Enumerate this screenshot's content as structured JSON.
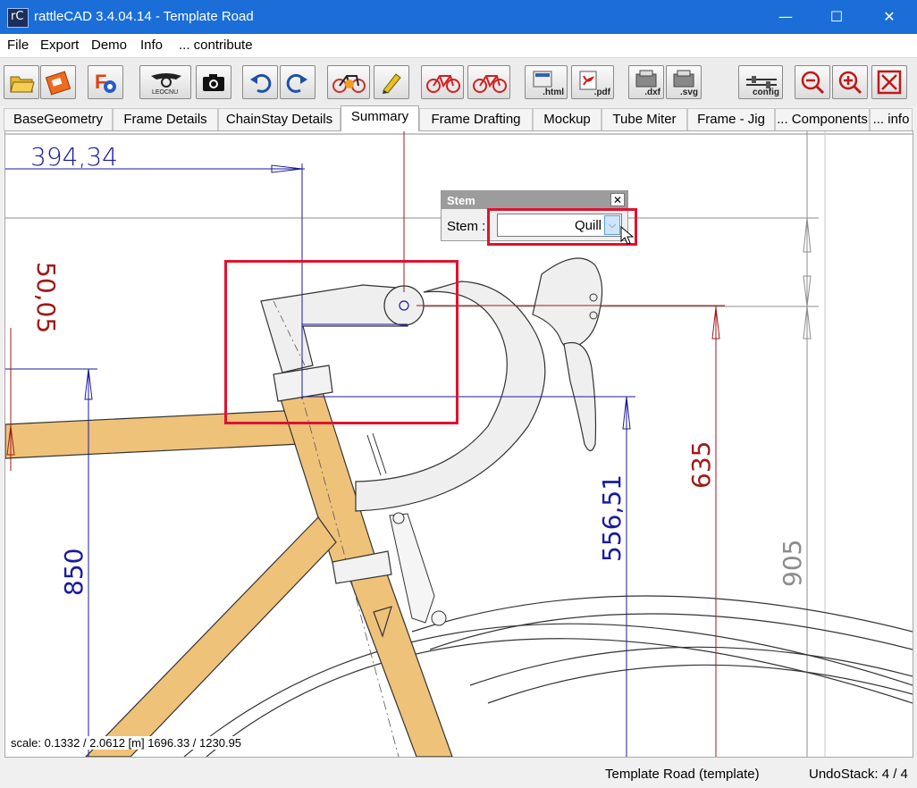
{
  "window": {
    "app_name": "rattleCAD",
    "title": "rattleCAD  3.4.04.14 - Template Road",
    "controls": {
      "minimize": "—",
      "maximize": "☐",
      "close": "✕"
    }
  },
  "menu": [
    "File",
    "Export",
    "Demo",
    "Info",
    "... contribute"
  ],
  "toolbar": {
    "buttons": [
      {
        "name": "open-folder-icon"
      },
      {
        "name": "save-icon"
      },
      {
        "name": "font-settings-icon"
      },
      {
        "name": "bike-logo-icon"
      },
      {
        "name": "camera-icon"
      },
      {
        "name": "undo-icon"
      },
      {
        "name": "redo-icon"
      },
      {
        "name": "frame-geometry-icon"
      },
      {
        "name": "pencil-icon"
      },
      {
        "name": "bike-red-icon"
      },
      {
        "name": "bike-red-icon-2"
      },
      {
        "name": "export-html-icon",
        "label": ".html"
      },
      {
        "name": "export-pdf-icon",
        "label": ".pdf"
      },
      {
        "name": "export-dxf-icon",
        "label": ".dxf"
      },
      {
        "name": "export-svg-icon",
        "label": ".svg"
      },
      {
        "name": "config-icon",
        "label": "config"
      },
      {
        "name": "zoom-out-icon"
      },
      {
        "name": "zoom-in-icon"
      },
      {
        "name": "fit-screen-icon"
      }
    ]
  },
  "tabs": [
    {
      "label": "BaseGeometry"
    },
    {
      "label": "Frame Details"
    },
    {
      "label": "ChainStay Details"
    },
    {
      "label": "Summary",
      "active": true
    },
    {
      "label": "Frame Drafting"
    },
    {
      "label": "Mockup"
    },
    {
      "label": "Tube Miter"
    },
    {
      "label": "Frame - Jig"
    },
    {
      "label": "... Components"
    },
    {
      "label": "... info"
    }
  ],
  "drawing": {
    "dimensions": {
      "reach_horizontal": "394,34",
      "offset": "50,05",
      "height_850": "850",
      "height_556": "556,51",
      "height_635": "635",
      "height_905": "905"
    },
    "scale_text": "scale: 0.1332 / 2.0612  [m]  1696.33 / 1230.95",
    "colors": {
      "blue_dim": "#1a1aa0",
      "red_dim": "#a01a1a",
      "grey_dim": "#8c8c8c",
      "frame_fill": "#efc27a",
      "highlight": "#e0122e"
    }
  },
  "stem_dialog": {
    "title": "Stem",
    "field_label": "Stem  :",
    "value": "Quill"
  },
  "status": {
    "template": "Template Road (template)",
    "undo": "UndoStack:  4 /  4"
  }
}
